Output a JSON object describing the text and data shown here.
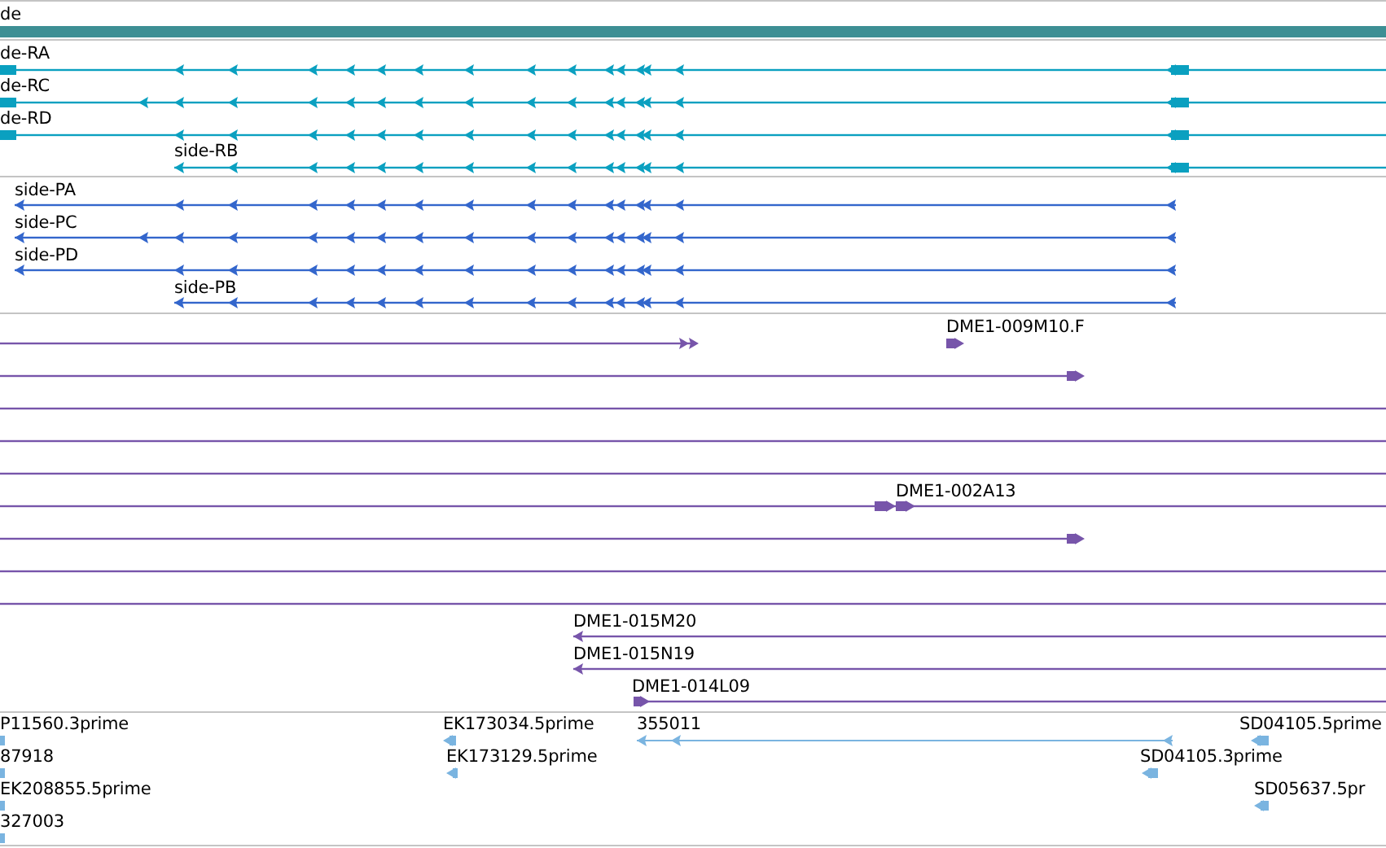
{
  "tracks": [
    {
      "kind": "gene",
      "color": "#3d8f94",
      "features": [
        {
          "kind": "bar",
          "label": "de"
        }
      ]
    },
    {
      "kind": "transcripts",
      "color": "#0aa0c0",
      "features": [
        {
          "kind": "minus",
          "label": "de-RA"
        },
        {
          "kind": "minus",
          "label": "de-RC"
        },
        {
          "kind": "minus",
          "label": "de-RD"
        },
        {
          "kind": "minus",
          "label": "side-RB"
        }
      ]
    },
    {
      "kind": "proteins",
      "color": "#3366cc",
      "features": [
        {
          "kind": "minus",
          "label": "side-PA"
        },
        {
          "kind": "minus",
          "label": "side-PC"
        },
        {
          "kind": "minus",
          "label": "side-PD"
        },
        {
          "kind": "minus",
          "label": "side-PB"
        }
      ]
    },
    {
      "kind": "alignments",
      "color": "#7755aa",
      "features": [
        {
          "kind": "plus",
          "label": "DME1-009M10.F"
        },
        {
          "kind": "plus"
        },
        {
          "kind": "line"
        },
        {
          "kind": "line"
        },
        {
          "kind": "line"
        },
        {
          "kind": "plus",
          "label": "DME1-002A13"
        },
        {
          "kind": "plus"
        },
        {
          "kind": "line"
        },
        {
          "kind": "line"
        },
        {
          "kind": "minus",
          "label": "DME1-015M20"
        },
        {
          "kind": "minus",
          "label": "DME1-015N19"
        },
        {
          "kind": "plus",
          "label": "DME1-014L09"
        }
      ]
    },
    {
      "kind": "ests",
      "color": "#7ab4e0",
      "features": [
        {
          "kind": "block",
          "label": "P11560.3prime"
        },
        {
          "kind": "minus",
          "label": "EK173034.5prime"
        },
        {
          "kind": "minus",
          "label": "355011"
        },
        {
          "kind": "minus",
          "label": "SD04105.5prime"
        },
        {
          "kind": "block",
          "label": "87918"
        },
        {
          "kind": "minus",
          "label": "EK173129.5prime"
        },
        {
          "kind": "minus",
          "label": "SD04105.3prime"
        },
        {
          "kind": "block",
          "label": "EK208855.5prime"
        },
        {
          "kind": "minus",
          "label": "SD05637.5pr"
        },
        {
          "kind": "block",
          "label": "327003"
        }
      ]
    }
  ]
}
